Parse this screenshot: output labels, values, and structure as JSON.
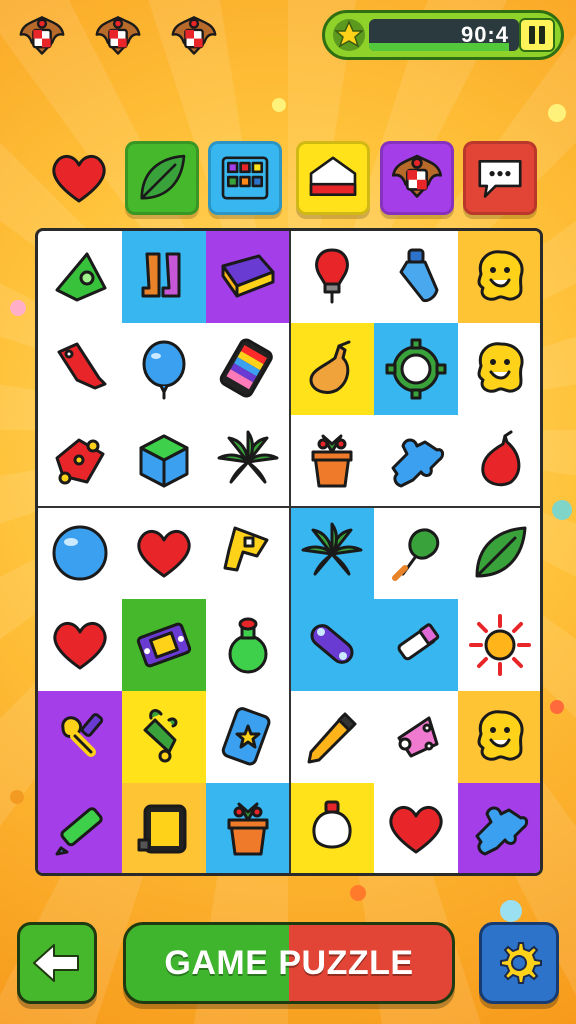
{
  "timer": {
    "value": "90:4",
    "progress": 0.93
  },
  "title_button": {
    "label": "GAME PUZZLE"
  },
  "colors": {
    "green": "#46b82c",
    "red": "#e24535",
    "blue": "#2d73c9",
    "cyan": "#37b6ef",
    "purple": "#a43ee8",
    "yellow": "#ffe21a",
    "orange": "#ffc433"
  },
  "header_badges": [
    "garuda-emblem-icon",
    "garuda-emblem-icon",
    "garuda-emblem-icon"
  ],
  "categories": [
    "heart-icon",
    "leaf-icon",
    "grid-icon",
    "flag-icon",
    "garuda-emblem-icon",
    "speech-bubble-icon"
  ],
  "board": [
    [
      "triangle-block-icon",
      "boots-icon",
      "book-icon",
      "bulb-icon",
      "bottle-icon",
      "blob-face-icon"
    ],
    [
      "price-tag-icon",
      "balloon-icon",
      "phone-icon",
      "gourd-icon",
      "gear-icon",
      "blob-face-icon"
    ],
    [
      "dice-icon",
      "cube-icon",
      "plant-icon",
      "flower-pot-icon",
      "puzzle-piece-icon",
      "drop-icon"
    ],
    [
      "ball-icon",
      "heart-icon",
      "key-block-icon",
      "plant-icon",
      "broccoli-icon",
      "leaf-icon"
    ],
    [
      "heart-icon",
      "console-icon",
      "potion-icon",
      "toggle-icon",
      "tube-icon",
      "sun-icon"
    ],
    [
      "pacifier-icon",
      "bell-icon",
      "star-phone-icon",
      "cone-icon",
      "kite-icon",
      "blob-face-icon"
    ],
    [
      "crayon-icon",
      "tablet-icon",
      "flower-pot-icon",
      "lightbulb-icon",
      "heart-icon",
      "puzzle-piece-icon"
    ]
  ],
  "backgrounds": [
    [
      "",
      "cyan",
      "purple",
      "",
      "",
      "orange"
    ],
    [
      "",
      "",
      "",
      "yellow",
      "cyan",
      ""
    ],
    [
      "",
      "",
      "",
      "",
      "",
      ""
    ],
    [
      "",
      "",
      "",
      "cyan",
      "",
      ""
    ],
    [
      "",
      "green",
      "",
      "cyan",
      "cyan",
      ""
    ],
    [
      "purple",
      "yellow",
      "",
      "",
      "",
      "orange"
    ],
    [
      "purple",
      "orange",
      "cyan",
      "yellow",
      "",
      "purple"
    ]
  ]
}
